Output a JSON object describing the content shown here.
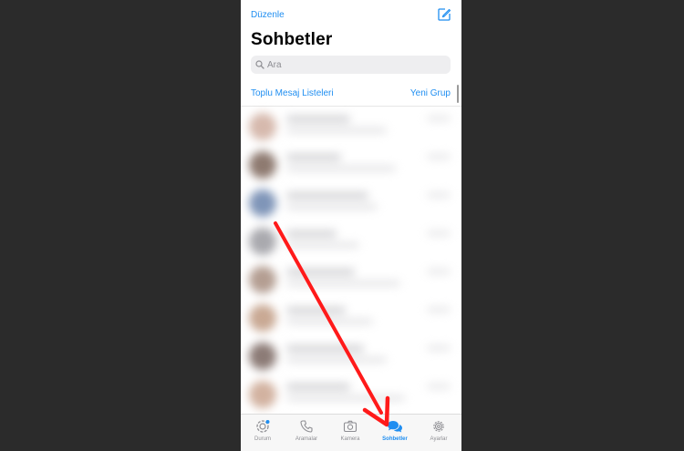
{
  "header": {
    "edit_label": "Düzenle",
    "title": "Sohbetler",
    "compose_icon": "compose-icon"
  },
  "search": {
    "placeholder": "Ara",
    "icon": "search-icon"
  },
  "actions": {
    "broadcast_label": "Toplu Mesaj Listeleri",
    "new_group_label": "Yeni Grup"
  },
  "tabbar": {
    "active": "Sohbetler",
    "tabs": [
      {
        "label": "Durum",
        "icon": "status-icon"
      },
      {
        "label": "Aramalar",
        "icon": "phone-icon"
      },
      {
        "label": "Kamera",
        "icon": "camera-icon"
      },
      {
        "label": "Sohbetler",
        "icon": "chat-bubbles-icon"
      },
      {
        "label": "Ayarlar",
        "icon": "gear-icon"
      }
    ]
  },
  "colors": {
    "accent": "#1f8ef1",
    "annotation_arrow": "#ff1a1a",
    "background": "#2b2b2b"
  }
}
